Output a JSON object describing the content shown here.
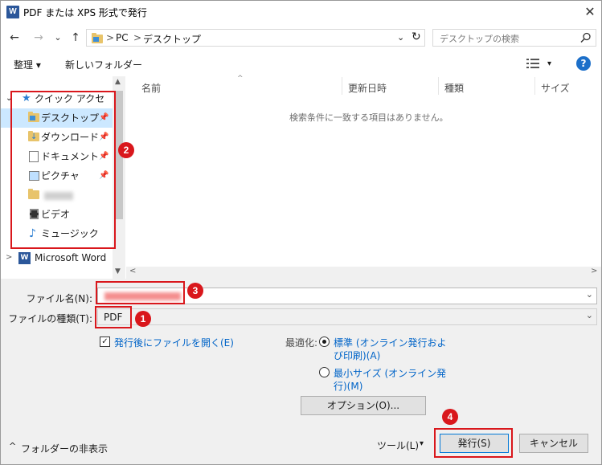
{
  "window": {
    "title": "PDF または XPS 形式で発行",
    "app_icon": "word-icon",
    "close_label": "✕"
  },
  "address": {
    "back": "←",
    "forward": "→",
    "history": "⌄",
    "up": "↑",
    "crumbs": [
      "PC",
      "デスクトップ"
    ],
    "separator": ">",
    "dropdown": "⌄",
    "refresh": "↻",
    "search_placeholder": "デスクトップの検索"
  },
  "toolbar": {
    "organize_label": "整理 ▾",
    "new_folder_label": "新しいフォルダー",
    "view_menu": "▾",
    "help_label": "?"
  },
  "nav": {
    "quick_access": "クイック アクセス",
    "items": [
      {
        "label": "デスクトップ",
        "pinned": true,
        "icon": "desktop-folder-icon"
      },
      {
        "label": "ダウンロード",
        "pinned": true,
        "icon": "download-folder-icon"
      },
      {
        "label": "ドキュメント",
        "pinned": true,
        "icon": "document-folder-icon"
      },
      {
        "label": "ピクチャ",
        "pinned": true,
        "icon": "picture-folder-icon"
      },
      {
        "label": "",
        "pinned": false,
        "icon": "folder-icon"
      },
      {
        "label": "ビデオ",
        "pinned": false,
        "icon": "video-folder-icon"
      },
      {
        "label": "ミュージック",
        "pinned": false,
        "icon": "music-folder-icon"
      }
    ],
    "word_item": "Microsoft Word",
    "pin_glyph": "📌"
  },
  "list": {
    "columns": [
      "名前",
      "更新日時",
      "種類",
      "サイズ"
    ],
    "empty_message": "検索条件に一致する項目はありません。"
  },
  "form": {
    "filename_label": "ファイル名(N):",
    "filetype_label": "ファイルの種類(T):",
    "filetype_value": "PDF",
    "open_after_label": "発行後にファイルを開く(E)",
    "optimize_label": "最適化:",
    "opt_standard_line1": "標準 (オンライン発行およ",
    "opt_standard_line2": "び印刷)(A)",
    "opt_min_line1": "最小サイズ (オンライン発",
    "opt_min_line2": "行)(M)",
    "options_button": "オプション(O)..."
  },
  "footer": {
    "hide_folders": "フォルダーの非表示",
    "tools_label": "ツール(L)",
    "tools_arrow": "▾",
    "publish_button": "発行(S)",
    "cancel_button": "キャンセル"
  },
  "annotations": {
    "badge1": "1",
    "badge2": "2",
    "badge3": "3",
    "badge4": "4",
    "color": "#d9171c"
  }
}
